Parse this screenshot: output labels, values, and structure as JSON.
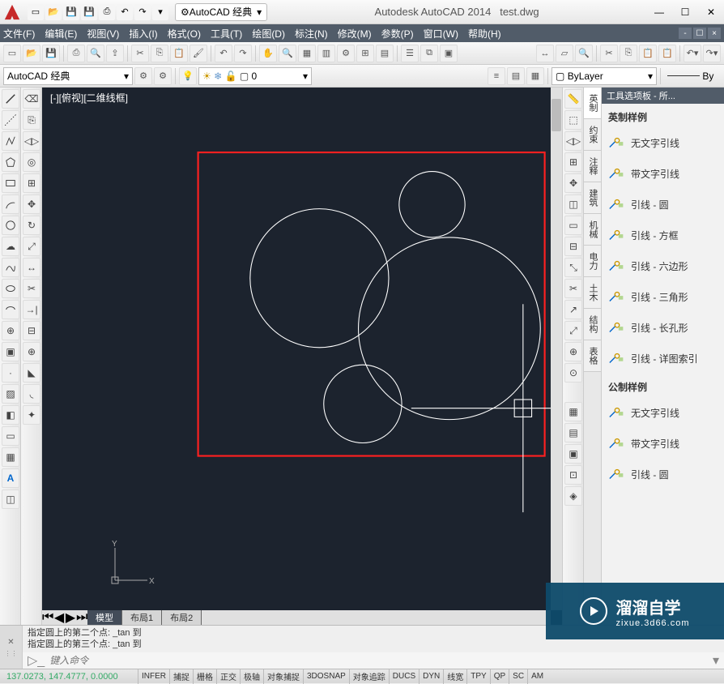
{
  "title": {
    "app": "Autodesk AutoCAD 2014",
    "doc": "test.dwg"
  },
  "workspace_label": "AutoCAD 经典",
  "menus": [
    "文件(F)",
    "编辑(E)",
    "视图(V)",
    "插入(I)",
    "格式(O)",
    "工具(T)",
    "绘图(D)",
    "标注(N)",
    "修改(M)",
    "参数(P)",
    "窗口(W)",
    "帮助(H)"
  ],
  "row2": {
    "workspace": "AutoCAD 经典",
    "layer_label": "0",
    "linetype": "ByLayer",
    "linetype2": "By"
  },
  "canvas": {
    "view_label": "[-][俯视][二维线框]"
  },
  "tabs": [
    "模型",
    "布局1",
    "布局2"
  ],
  "palette": {
    "title": "工具选项板 - 所...",
    "section1": "英制样例",
    "section2": "公制样例",
    "items1": [
      "无文字引线",
      "带文字引线",
      "引线 - 圆",
      "引线 - 方框",
      "引线 - 六边形",
      "引线 - 三角形",
      "引线 - 长孔形",
      "引线 - 详图索引"
    ],
    "items2": [
      "无文字引线",
      "带文字引线",
      "引线 - 圆"
    ]
  },
  "vtabs": [
    "英制",
    "约束",
    "注释",
    "建筑",
    "机械",
    "电力",
    "土木",
    "结构",
    "表格"
  ],
  "cmd": {
    "line1": "指定圆上的第二个点:  _tan 到",
    "line2": "指定圆上的第三个点:  _tan 到",
    "placeholder": "键入命令"
  },
  "status": {
    "coords": "137.0273, 147.4777, 0.0000",
    "buttons": [
      "INFER",
      "捕捉",
      "栅格",
      "正交",
      "极轴",
      "对象捕捉",
      "3DOSNAP",
      "对象追踪",
      "DUCS",
      "DYN",
      "线宽",
      "TPY",
      "QP",
      "SC",
      "AM"
    ]
  },
  "watermark": {
    "t1": "溜溜自学",
    "t2": "zixue.3d66.com"
  }
}
